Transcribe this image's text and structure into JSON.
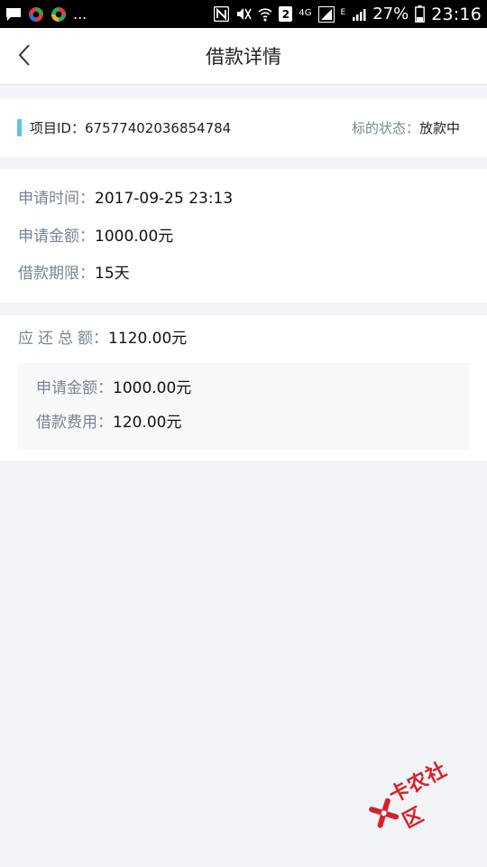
{
  "status_bar": {
    "notif_dots": "...",
    "sim_badge": "2",
    "network": "4G",
    "edge": "E",
    "battery": "27%",
    "time": "23:16"
  },
  "nav": {
    "title": "借款详情",
    "back_icon": "chevron-left-icon"
  },
  "project": {
    "id_label": "项目ID：",
    "id_value": "67577402036854784",
    "status_label": "标的状态：",
    "status_value": "放款中",
    "accent_color": "#5ac4ea"
  },
  "info": {
    "apply_time_label": "申请时间：",
    "apply_time_value": "2017-09-25 23:13",
    "apply_amount_label": "申请金额：",
    "apply_amount_value": "1000.00元",
    "term_label": "借款期限：",
    "term_value": "15天"
  },
  "total": {
    "label_chars": [
      "应",
      "还",
      "总",
      "额"
    ],
    "label_colon": "：",
    "value": "1120.00元",
    "breakdown": {
      "amount_label": "申请金额：",
      "amount_value": "1000.00元",
      "fee_label": "借款费用：",
      "fee_value": "120.00元"
    }
  },
  "watermark": {
    "text": "卡农社区",
    "color": "#d9202a"
  }
}
